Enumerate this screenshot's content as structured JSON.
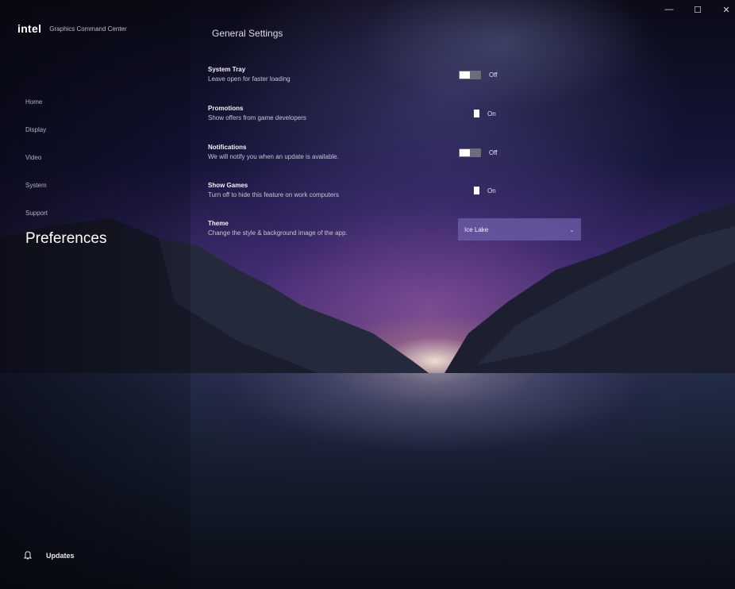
{
  "app": {
    "logo": "intel",
    "title": "Graphics Command Center",
    "window_controls": [
      "—",
      "☐",
      "✕"
    ]
  },
  "nav": {
    "items": [
      {
        "label": "Home",
        "active": false
      },
      {
        "label": "Display",
        "active": false
      },
      {
        "label": "Video",
        "active": false
      },
      {
        "label": "System",
        "active": false
      },
      {
        "label": "Support",
        "active": false
      },
      {
        "label": "Preferences",
        "active": true
      }
    ],
    "updates_label": "Updates",
    "updates_icon": "bell-icon"
  },
  "main": {
    "page_title": "General Settings",
    "settings": [
      {
        "title": "System Tray",
        "desc": "Leave open for faster loading",
        "toggle": "Off"
      },
      {
        "title": "Promotions",
        "desc": "Show offers from game developers",
        "toggle": "On"
      },
      {
        "title": "Notifications",
        "desc": "We will notify you when an update is available.",
        "toggle": "Off"
      },
      {
        "title": "Show Games",
        "desc": "Turn off to hide this feature on work computers",
        "toggle": "On"
      },
      {
        "title": "Theme",
        "desc": "Change the style & background image of the app.",
        "dropdown_value": "Ice Lake"
      }
    ]
  },
  "colors": {
    "accent": "#6e5faa",
    "toggle_off_track": "#6b6d7a",
    "toggle_knob": "#ffffff"
  }
}
